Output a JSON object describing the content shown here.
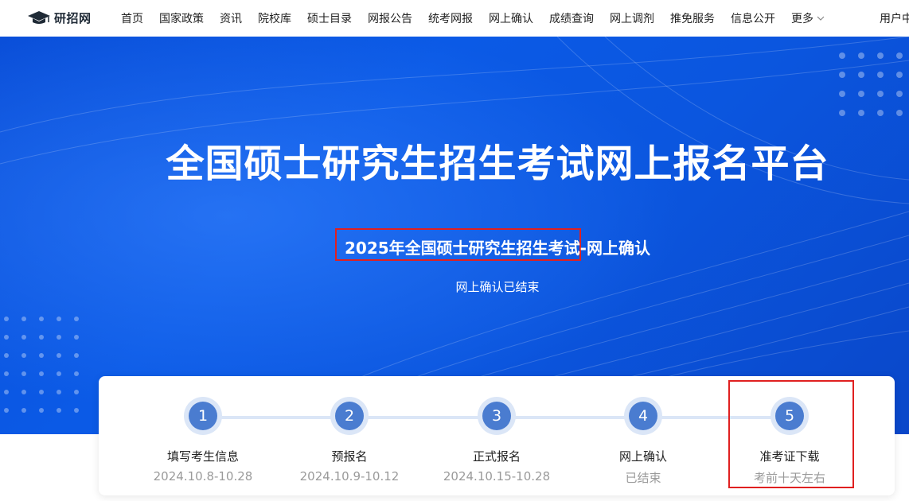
{
  "brand": {
    "logo_text": "研招网"
  },
  "nav": {
    "items": [
      "首页",
      "国家政策",
      "资讯",
      "院校库",
      "硕士目录",
      "网报公告",
      "统考网报",
      "网上确认",
      "成绩查询",
      "网上调剂",
      "推免服务",
      "信息公开"
    ],
    "more": "更多",
    "user_center": "用户中"
  },
  "hero": {
    "title": "全国硕士研究生招生考试网上报名平台",
    "subtitle_part1": "2025年全国硕士研究生招生考试",
    "subtitle_part2": "-网上确认",
    "status": "网上确认已结束"
  },
  "steps": [
    {
      "num": "1",
      "name": "填写考生信息",
      "date": "2024.10.8-10.28"
    },
    {
      "num": "2",
      "name": "预报名",
      "date": "2024.10.9-10.12"
    },
    {
      "num": "3",
      "name": "正式报名",
      "date": "2024.10.15-10.28"
    },
    {
      "num": "4",
      "name": "网上确认",
      "date": "已结束"
    },
    {
      "num": "5",
      "name": "准考证下载",
      "date": "考前十天左右"
    }
  ],
  "colors": {
    "hero_blue": "#0b56df",
    "step_blue": "#4a7cd0",
    "highlight_red": "#e02020"
  }
}
